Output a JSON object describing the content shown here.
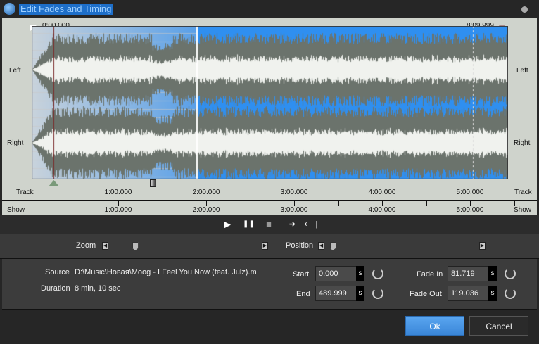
{
  "window": {
    "title": "Edit Fades and Timing"
  },
  "waveform": {
    "start_label": "0:00.000",
    "end_label": "8:09.999",
    "left_label": "Left",
    "right_label": "Right",
    "fade_in_s": 81.719,
    "fade_out_s": 119.036,
    "duration_s": 489.999,
    "colors": {
      "wave_bg": "#2f8ff0",
      "wave": "#6b736c",
      "wave_peak": "#f0f2ee",
      "panel": "#cfd3cc"
    }
  },
  "track_ruler": {
    "label": "Track",
    "ticks": [
      "1:00.000",
      "2:00.000",
      "3:00.000",
      "4:00.000",
      "5:00.000"
    ]
  },
  "show_ruler": {
    "label": "Show",
    "ticks": [
      "1:00.000",
      "2:00.000",
      "3:00.000",
      "4:00.000",
      "5:00.000"
    ]
  },
  "controls": {
    "play": "▶",
    "pause": "❚❚",
    "stop": "■",
    "mark_in": "|➔",
    "mark_out": "⟵|"
  },
  "sliders": {
    "zoom_label": "Zoom",
    "zoom_value": 0.17,
    "position_label": "Position",
    "position_value": 0.03
  },
  "info": {
    "source_label": "Source",
    "source_value": "D:\\Music\\Новая\\Moog - I Feel You Now (feat. Julz).mp",
    "duration_label": "Duration",
    "duration_value": "8 min, 10 sec"
  },
  "timing": {
    "start_label": "Start",
    "start_value": "0.000",
    "end_label": "End",
    "end_value": "489.999",
    "fade_in_label": "Fade In",
    "fade_in_value": "81.719",
    "fade_out_label": "Fade Out",
    "fade_out_value": "119.036",
    "unit": "s"
  },
  "buttons": {
    "ok": "Ok",
    "cancel": "Cancel"
  }
}
